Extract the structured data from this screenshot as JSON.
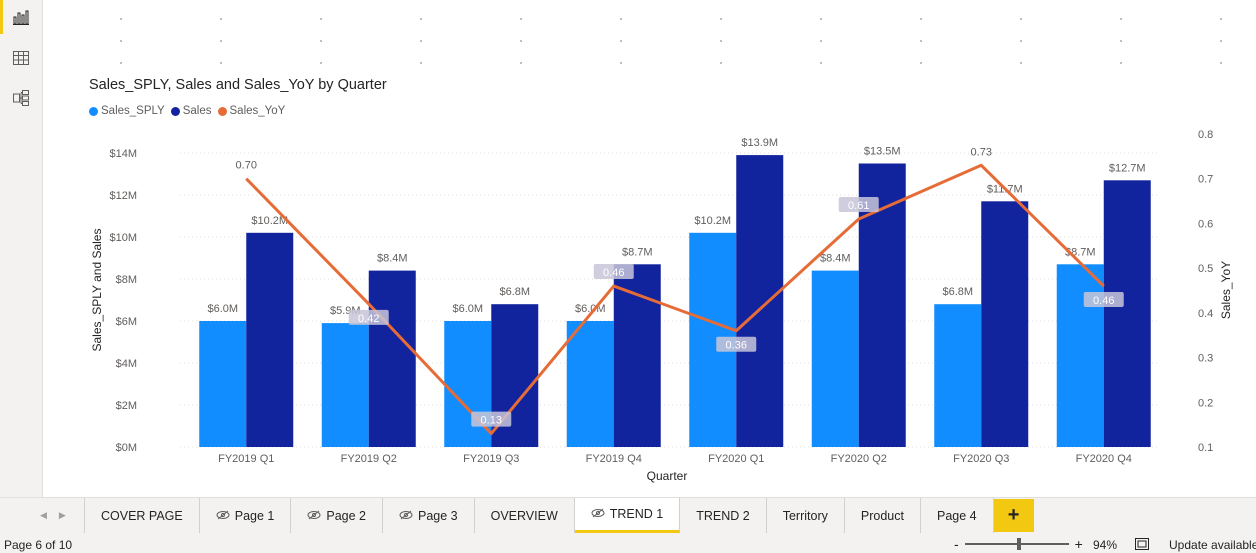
{
  "left_rail": {
    "items": [
      {
        "name": "report-view",
        "icon": "bar-chart-icon",
        "active": true
      },
      {
        "name": "data-view",
        "icon": "table-icon",
        "active": false
      },
      {
        "name": "model-view",
        "icon": "model-icon",
        "active": false
      }
    ]
  },
  "chart_data": {
    "type": "bar",
    "title": "Sales_SPLY, Sales and Sales_YoY by Quarter",
    "xlabel": "Quarter",
    "ylabel": "Sales_SPLY and Sales",
    "y2label": "Sales_YoY",
    "categories": [
      "FY2019 Q1",
      "FY2019 Q2",
      "FY2019 Q3",
      "FY2019 Q4",
      "FY2020 Q1",
      "FY2020 Q2",
      "FY2020 Q3",
      "FY2020 Q4"
    ],
    "series": [
      {
        "name": "Sales_SPLY",
        "type": "bar",
        "color": "#118dff",
        "values": [
          6.0,
          5.9,
          6.0,
          6.0,
          10.2,
          8.4,
          6.8,
          8.7
        ],
        "labels": [
          "$6.0M",
          "$5.9M",
          "$6.0M",
          "$6.0M",
          "$10.2M",
          "$8.4M",
          "$6.8M",
          "$8.7M"
        ]
      },
      {
        "name": "Sales",
        "type": "bar",
        "color": "#12239e",
        "values": [
          10.2,
          8.4,
          6.8,
          8.7,
          13.9,
          13.5,
          11.7,
          12.7
        ],
        "labels": [
          "$10.2M",
          "$8.4M",
          "$6.8M",
          "$8.7M",
          "$13.9M",
          "$13.5M",
          "$11.7M",
          "$12.7M"
        ]
      },
      {
        "name": "Sales_YoY",
        "type": "line",
        "axis": "right",
        "color": "#e66c37",
        "values": [
          0.7,
          0.42,
          0.13,
          0.46,
          0.36,
          0.61,
          0.73,
          0.46
        ],
        "labels": [
          "0.70",
          "0.42",
          "0.13",
          "0.46",
          "0.36",
          "0.61",
          "0.73",
          "0.46"
        ]
      }
    ],
    "ylim": [
      0,
      14
    ],
    "y_ticks": [
      "$0M",
      "$2M",
      "$4M",
      "$6M",
      "$8M",
      "$10M",
      "$12M",
      "$14M"
    ],
    "y_tick_values": [
      0,
      2,
      4,
      6,
      8,
      10,
      12,
      14
    ],
    "y2lim": [
      0.1,
      0.8
    ],
    "y2_ticks": [
      "0.1",
      "0.2",
      "0.3",
      "0.4",
      "0.5",
      "0.6",
      "0.7",
      "0.8"
    ],
    "y2_tick_values": [
      0.1,
      0.2,
      0.3,
      0.4,
      0.5,
      0.6,
      0.7,
      0.8
    ],
    "grid": true,
    "legend_position": "top-left"
  },
  "tabs": [
    {
      "label": "COVER PAGE",
      "hidden": false,
      "active": false
    },
    {
      "label": "Page 1",
      "hidden": true,
      "active": false
    },
    {
      "label": "Page 2",
      "hidden": true,
      "active": false
    },
    {
      "label": "Page 3",
      "hidden": true,
      "active": false
    },
    {
      "label": "OVERVIEW",
      "hidden": false,
      "active": false
    },
    {
      "label": "TREND 1",
      "hidden": true,
      "active": true
    },
    {
      "label": "TREND 2",
      "hidden": false,
      "active": false
    },
    {
      "label": "Territory",
      "hidden": false,
      "active": false
    },
    {
      "label": "Product",
      "hidden": false,
      "active": false
    },
    {
      "label": "Page 4",
      "hidden": false,
      "active": false
    }
  ],
  "add_tab_label": "+",
  "status_bar": {
    "page_indicator": "Page 6 of 10",
    "zoom_minus": "-",
    "zoom_plus": "+",
    "zoom_level": "94%",
    "zoom_fraction": 0.5,
    "update_text": "Update available"
  }
}
